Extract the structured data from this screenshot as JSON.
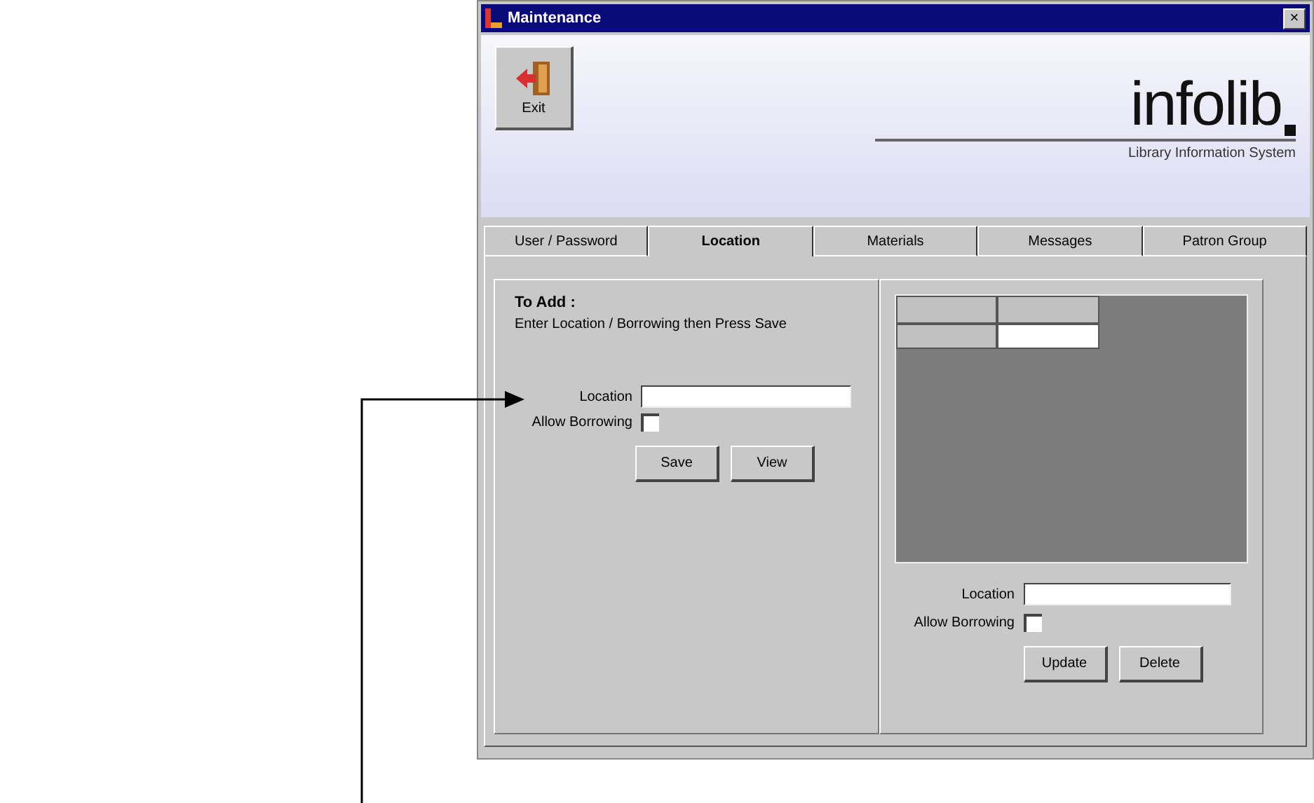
{
  "window": {
    "title": "Maintenance",
    "close": "×"
  },
  "toolbar": {
    "exit_label": "Exit"
  },
  "brand": {
    "logo": "infolib",
    "tagline": "Library Information System"
  },
  "tabs": [
    {
      "label": "User / Password",
      "selected": false
    },
    {
      "label": "Location",
      "selected": true
    },
    {
      "label": "Materials",
      "selected": false
    },
    {
      "label": "Messages",
      "selected": false
    },
    {
      "label": "Patron Group",
      "selected": false
    }
  ],
  "add_panel": {
    "heading": "To Add :",
    "instruction": "Enter Location / Borrowing then Press Save",
    "location": {
      "label": "Location"
    },
    "borrowing": {
      "label": "Allow Borrowing",
      "checked": false
    },
    "buttons": [
      "Save",
      "View"
    ]
  },
  "edit_panel": {
    "location": {
      "label": "Location"
    },
    "borrowing": {
      "label": "Allow Borrowing",
      "checked": false
    },
    "buttons": [
      "Update",
      "Delete"
    ]
  }
}
